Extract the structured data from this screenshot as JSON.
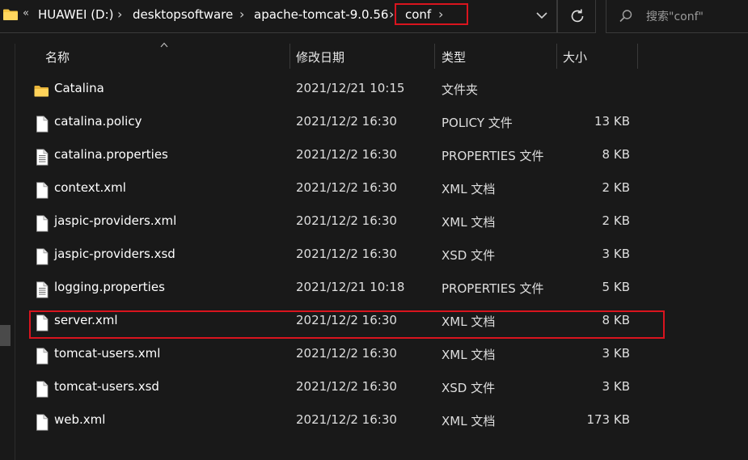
{
  "address_bar": {
    "overflow": "«",
    "breadcrumbs": [
      "HUAWEI (D:)",
      "desktopsoftware",
      "apache-tomcat-9.0.56",
      "conf"
    ],
    "separator": "›"
  },
  "search": {
    "placeholder": "搜索\"conf\""
  },
  "columns": {
    "name": "名称",
    "date": "修改日期",
    "type": "类型",
    "size": "大小"
  },
  "files": [
    {
      "name": "Catalina",
      "date": "2021/12/21 10:15",
      "type": "文件夹",
      "size": "",
      "icon": "folder-icon"
    },
    {
      "name": "catalina.policy",
      "date": "2021/12/2 16:30",
      "type": "POLICY 文件",
      "size": "13 KB",
      "icon": "file-icon"
    },
    {
      "name": "catalina.properties",
      "date": "2021/12/2 16:30",
      "type": "PROPERTIES 文件",
      "size": "8 KB",
      "icon": "settings-file-icon"
    },
    {
      "name": "context.xml",
      "date": "2021/12/2 16:30",
      "type": "XML 文档",
      "size": "2 KB",
      "icon": "file-icon"
    },
    {
      "name": "jaspic-providers.xml",
      "date": "2021/12/2 16:30",
      "type": "XML 文档",
      "size": "2 KB",
      "icon": "file-icon"
    },
    {
      "name": "jaspic-providers.xsd",
      "date": "2021/12/2 16:30",
      "type": "XSD 文件",
      "size": "3 KB",
      "icon": "file-icon"
    },
    {
      "name": "logging.properties",
      "date": "2021/12/21 10:18",
      "type": "PROPERTIES 文件",
      "size": "5 KB",
      "icon": "settings-file-icon"
    },
    {
      "name": "server.xml",
      "date": "2021/12/2 16:30",
      "type": "XML 文档",
      "size": "8 KB",
      "icon": "file-icon"
    },
    {
      "name": "tomcat-users.xml",
      "date": "2021/12/2 16:30",
      "type": "XML 文档",
      "size": "3 KB",
      "icon": "file-icon"
    },
    {
      "name": "tomcat-users.xsd",
      "date": "2021/12/2 16:30",
      "type": "XSD 文件",
      "size": "3 KB",
      "icon": "file-icon"
    },
    {
      "name": "web.xml",
      "date": "2021/12/2 16:30",
      "type": "XML 文档",
      "size": "173 KB",
      "icon": "file-icon"
    }
  ],
  "colors": {
    "background": "#191919",
    "highlight": "#d9141e",
    "folder": "#f4c542"
  }
}
